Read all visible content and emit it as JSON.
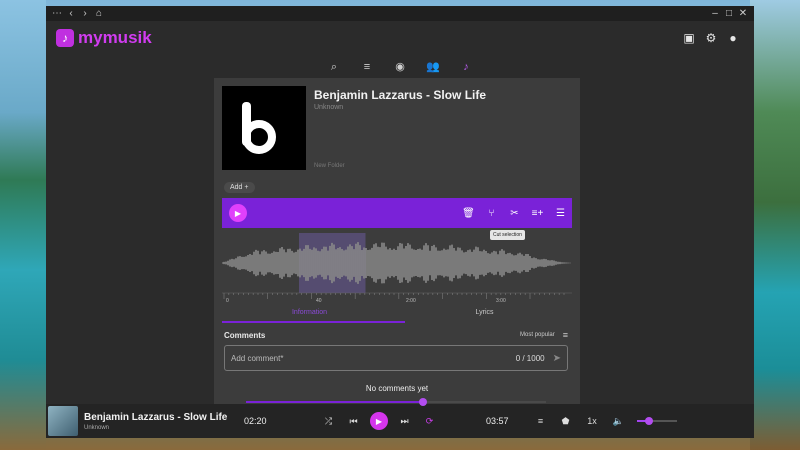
{
  "app": {
    "name": "mymusik",
    "accent": "#7a22d8",
    "brand": "#d13cf0"
  },
  "titlebar": {
    "buttons": [
      "more-icon",
      "back-icon",
      "forward-icon",
      "home-icon"
    ],
    "window_controls": [
      "minimize-icon",
      "maximize-icon",
      "close-icon"
    ]
  },
  "header": {
    "icons": [
      "library-icon",
      "settings-icon",
      "account-icon"
    ]
  },
  "nav": {
    "icons": [
      "search-icon",
      "queue-icon",
      "album-icon",
      "people-icon",
      "music-note-icon"
    ],
    "active": "music-note-icon"
  },
  "track": {
    "title": "Benjamin Lazzarus - Slow Life",
    "artist": "Unknown",
    "folder": "New Folder",
    "add_label": "Add"
  },
  "toolbar": {
    "tools": [
      "delete-icon",
      "split-icon",
      "cut-icon",
      "add-to-queue-icon",
      "playlist-icon"
    ],
    "tooltip": "Cut selection"
  },
  "timeline": {
    "ticks": [
      "0",
      "",
      "40",
      "",
      "2:00",
      "",
      "3:00",
      ""
    ]
  },
  "waveform": {
    "selection": {
      "start": 0.22,
      "end": 0.41
    }
  },
  "tabs": [
    {
      "label": "Information",
      "active": true
    },
    {
      "label": "Lyrics",
      "active": false
    }
  ],
  "comments": {
    "title": "Comments",
    "sort_label": "Most popular",
    "placeholder": "Add comment*",
    "count": "0 / 1000",
    "empty": "No comments yet"
  },
  "player": {
    "title": "Benjamin Lazzarus - Slow Life",
    "artist": "Unknown",
    "elapsed": "02:20",
    "duration": "03:57",
    "progress": 0.59,
    "rate": "1x",
    "volume": 0.3
  }
}
